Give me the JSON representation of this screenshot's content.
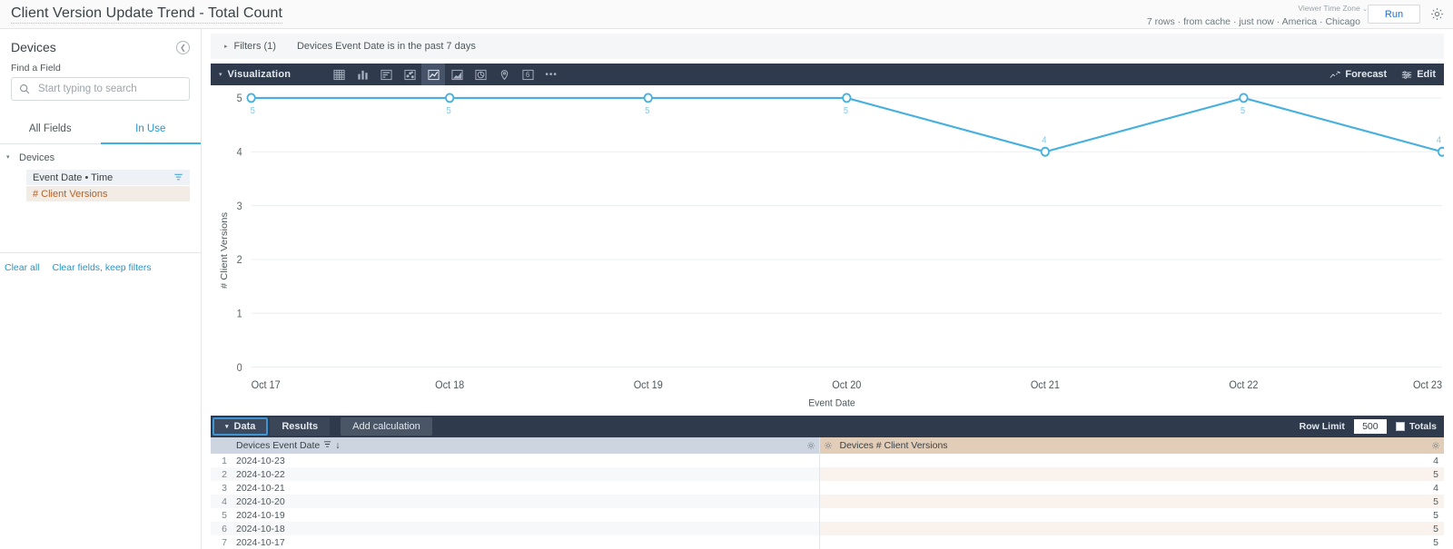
{
  "topbar": {
    "title": "Client Version Update Trend - Total Count",
    "query_meta": "7 rows · from cache · just now · America · Chicago",
    "timezone_label": "Viewer Time Zone",
    "timezone_caret": "⌄",
    "run_label": "Run",
    "settings_icon": "gear-icon"
  },
  "sidebar": {
    "model_title": "Devices",
    "collapse_icon": "chevron-left-icon",
    "find_label": "Find a Field",
    "search_placeholder": "Start typing to search",
    "search_value": "",
    "tabs": [
      {
        "label": "All Fields",
        "active": false
      },
      {
        "label": "In Use",
        "active": true
      }
    ],
    "group": {
      "caret": "▾",
      "label": "Devices"
    },
    "fields": [
      {
        "label": "Event Date • Time",
        "type": "dimension",
        "has_filter_icon": true
      },
      {
        "label": "# Client Versions",
        "type": "measure",
        "has_filter_icon": false
      }
    ],
    "links": [
      {
        "label": "Clear all"
      },
      {
        "label": "Clear fields, keep filters"
      }
    ]
  },
  "filters": {
    "caret": "▸",
    "label": "Filters (1)",
    "description": "Devices Event Date is in the past 7 days"
  },
  "visualization": {
    "caret": "▾",
    "title": "Visualization",
    "icons": [
      {
        "name": "table-viz-icon",
        "selected": false
      },
      {
        "name": "column-chart-icon",
        "selected": false
      },
      {
        "name": "bar-chart-icon",
        "selected": false
      },
      {
        "name": "scatter-plot-icon",
        "selected": false
      },
      {
        "name": "line-chart-icon",
        "selected": true
      },
      {
        "name": "area-chart-icon",
        "selected": false
      },
      {
        "name": "pie-chart-icon",
        "selected": false
      },
      {
        "name": "map-icon",
        "selected": false
      },
      {
        "name": "single-value-icon",
        "selected": false,
        "glyph": "6"
      },
      {
        "name": "more-viz-icon",
        "selected": false,
        "glyph": "•••"
      }
    ],
    "forecast_label": "Forecast",
    "edit_label": "Edit"
  },
  "chart_data": {
    "type": "line",
    "title": "",
    "xlabel": "Event Date",
    "ylabel": "# Client Versions",
    "categories": [
      "Oct 17",
      "Oct 18",
      "Oct 19",
      "Oct 20",
      "Oct 21",
      "Oct 22",
      "Oct 23"
    ],
    "values": [
      5,
      5,
      5,
      5,
      4,
      5,
      4
    ],
    "point_labels": [
      "5",
      "5",
      "5",
      "5",
      "4",
      "5",
      "4"
    ],
    "label_positions": [
      "below",
      "below",
      "below",
      "below",
      "above",
      "below",
      "above"
    ],
    "ylim": [
      0,
      5
    ],
    "yticks": [
      0,
      1,
      2,
      3,
      4,
      5
    ],
    "ytick_labels": [
      "0",
      "1",
      "2",
      "3",
      "4",
      "5"
    ],
    "grid": true,
    "legend": "none",
    "series_color": "#46b0de",
    "label_color": "#7ec9e8"
  },
  "data_panel": {
    "tabs": [
      {
        "label": "Data",
        "caret": "▾",
        "active": true
      },
      {
        "label": "Results",
        "active": false
      },
      {
        "label": "Add calculation",
        "active": false
      }
    ],
    "row_limit_label": "Row Limit",
    "row_limit_value": "500",
    "totals_label": "Totals",
    "totals_checked": false
  },
  "results_table": {
    "columns": [
      {
        "label": "Devices Event Date",
        "type": "dimension",
        "sort_icon": "↓",
        "filter_icon": "filter-icon",
        "gear_icon": "gear-icon"
      },
      {
        "label": "Devices # Client Versions",
        "type": "measure",
        "gear_icon": "gear-icon"
      }
    ],
    "rows": [
      {
        "n": "1",
        "date": "2024-10-23",
        "value": "4"
      },
      {
        "n": "2",
        "date": "2024-10-22",
        "value": "5"
      },
      {
        "n": "3",
        "date": "2024-10-21",
        "value": "4"
      },
      {
        "n": "4",
        "date": "2024-10-20",
        "value": "5"
      },
      {
        "n": "5",
        "date": "2024-10-19",
        "value": "5"
      },
      {
        "n": "6",
        "date": "2024-10-18",
        "value": "5"
      },
      {
        "n": "7",
        "date": "2024-10-17",
        "value": "5"
      }
    ]
  }
}
